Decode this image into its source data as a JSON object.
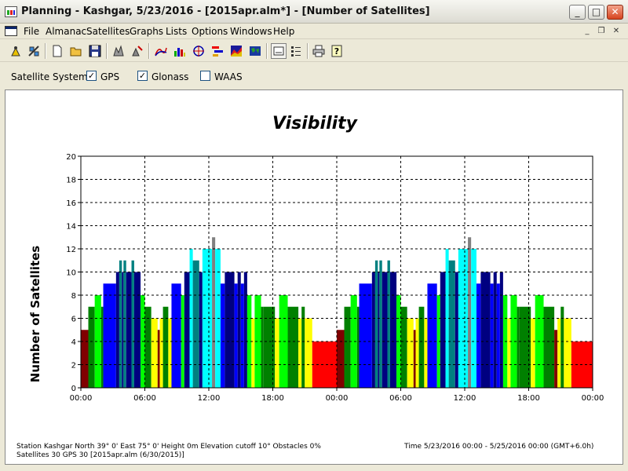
{
  "window": {
    "title": "Planning - Kashgar, 5/23/2016 - [2015apr.alm*] - [Number of Satellites]",
    "buttons": {
      "minimize": "_",
      "maximize": "□",
      "close": "✕"
    }
  },
  "menu": {
    "items": [
      "File",
      "Almanac",
      "Satellites",
      "Graphs",
      "Lists",
      "Options",
      "Windows",
      "Help"
    ],
    "mdi_controls": {
      "minimize": "_",
      "restore": "❐",
      "close": "✕"
    }
  },
  "toolbar": {
    "icons": [
      "station-icon",
      "satellite-icon",
      "new-icon",
      "open-icon",
      "save-icon",
      "obstacle-icon",
      "obstacle-edit-icon",
      "elevation-icon",
      "number-of-satellites-icon",
      "sky-plot-icon",
      "visibility-icon",
      "dop-icon",
      "world-view-icon",
      "view-toggle-icon",
      "legend-icon",
      "print-icon",
      "help-icon"
    ]
  },
  "options": {
    "label": "Satellite Systems:",
    "systems": [
      {
        "name": "GPS",
        "checked": true,
        "mark": "✓"
      },
      {
        "name": "Glonass",
        "checked": true,
        "mark": "✓"
      },
      {
        "name": "WAAS",
        "checked": false,
        "mark": ""
      }
    ]
  },
  "chart_data": {
    "type": "bar",
    "title": "Visibility",
    "ylabel": "Number of Satellites",
    "xlabel": "",
    "ylim": [
      0,
      20
    ],
    "yticks": [
      "0",
      "2",
      "4",
      "6",
      "8",
      "10",
      "12",
      "14",
      "16",
      "18",
      "20"
    ],
    "xticks": [
      "00:00",
      "06:00",
      "12:00",
      "18:00",
      "00:00",
      "06:00",
      "12:00",
      "18:00",
      "00:00"
    ],
    "x_range_hours": [
      0,
      48
    ],
    "grid": true,
    "colors": {
      "4": "#ff0000",
      "5": "#800000",
      "6": "#ffff00",
      "7": "#008000",
      "8": "#00ff00",
      "9": "#0000ff",
      "10": "#000080",
      "11": "#008080",
      "12": "#00ffff",
      "13": "#808080"
    },
    "segments": [
      {
        "start": 0.0,
        "end": 0.7,
        "value": 5
      },
      {
        "start": 0.7,
        "end": 1.3,
        "value": 7
      },
      {
        "start": 1.3,
        "end": 1.9,
        "value": 8
      },
      {
        "start": 1.9,
        "end": 2.1,
        "value": 7
      },
      {
        "start": 2.1,
        "end": 3.3,
        "value": 9
      },
      {
        "start": 3.3,
        "end": 3.6,
        "value": 10
      },
      {
        "start": 3.6,
        "end": 3.85,
        "value": 11
      },
      {
        "start": 3.85,
        "end": 4.0,
        "value": 10
      },
      {
        "start": 4.0,
        "end": 4.25,
        "value": 11
      },
      {
        "start": 4.25,
        "end": 4.75,
        "value": 10
      },
      {
        "start": 4.75,
        "end": 5.0,
        "value": 11
      },
      {
        "start": 5.0,
        "end": 5.6,
        "value": 10
      },
      {
        "start": 5.6,
        "end": 6.0,
        "value": 8
      },
      {
        "start": 6.0,
        "end": 6.6,
        "value": 7
      },
      {
        "start": 6.6,
        "end": 7.2,
        "value": 6
      },
      {
        "start": 7.2,
        "end": 7.4,
        "value": 5
      },
      {
        "start": 7.4,
        "end": 7.7,
        "value": 6
      },
      {
        "start": 7.7,
        "end": 8.2,
        "value": 7
      },
      {
        "start": 8.2,
        "end": 8.5,
        "value": 6
      },
      {
        "start": 8.5,
        "end": 9.4,
        "value": 9
      },
      {
        "start": 9.4,
        "end": 9.7,
        "value": 8
      },
      {
        "start": 9.7,
        "end": 10.2,
        "value": 10
      },
      {
        "start": 10.2,
        "end": 10.5,
        "value": 12
      },
      {
        "start": 10.5,
        "end": 11.1,
        "value": 11
      },
      {
        "start": 11.1,
        "end": 11.4,
        "value": 10
      },
      {
        "start": 11.4,
        "end": 12.3,
        "value": 12
      },
      {
        "start": 12.3,
        "end": 12.6,
        "value": 13
      },
      {
        "start": 12.6,
        "end": 13.1,
        "value": 12
      },
      {
        "start": 13.1,
        "end": 13.5,
        "value": 9
      },
      {
        "start": 13.5,
        "end": 14.4,
        "value": 10
      },
      {
        "start": 14.4,
        "end": 14.7,
        "value": 9
      },
      {
        "start": 14.7,
        "end": 15.0,
        "value": 10
      },
      {
        "start": 15.0,
        "end": 15.3,
        "value": 9
      },
      {
        "start": 15.3,
        "end": 15.6,
        "value": 10
      },
      {
        "start": 15.6,
        "end": 16.0,
        "value": 8
      },
      {
        "start": 16.0,
        "end": 16.3,
        "value": 6
      },
      {
        "start": 16.3,
        "end": 16.9,
        "value": 8
      },
      {
        "start": 16.9,
        "end": 17.1,
        "value": 7
      },
      {
        "start": 17.1,
        "end": 18.2,
        "value": 7
      },
      {
        "start": 18.2,
        "end": 18.6,
        "value": 6
      },
      {
        "start": 18.6,
        "end": 19.4,
        "value": 8
      },
      {
        "start": 19.4,
        "end": 20.4,
        "value": 7
      },
      {
        "start": 20.4,
        "end": 20.7,
        "value": 6
      },
      {
        "start": 20.7,
        "end": 21.0,
        "value": 7
      },
      {
        "start": 21.0,
        "end": 21.7,
        "value": 6
      },
      {
        "start": 21.7,
        "end": 24.0,
        "value": 4
      },
      {
        "start": 24.0,
        "end": 24.7,
        "value": 5
      },
      {
        "start": 24.7,
        "end": 25.3,
        "value": 7
      },
      {
        "start": 25.3,
        "end": 25.9,
        "value": 8
      },
      {
        "start": 25.9,
        "end": 26.1,
        "value": 7
      },
      {
        "start": 26.1,
        "end": 27.3,
        "value": 9
      },
      {
        "start": 27.3,
        "end": 27.6,
        "value": 10
      },
      {
        "start": 27.6,
        "end": 27.85,
        "value": 11
      },
      {
        "start": 27.85,
        "end": 28.0,
        "value": 10
      },
      {
        "start": 28.0,
        "end": 28.25,
        "value": 11
      },
      {
        "start": 28.25,
        "end": 28.75,
        "value": 10
      },
      {
        "start": 28.75,
        "end": 29.0,
        "value": 11
      },
      {
        "start": 29.0,
        "end": 29.6,
        "value": 10
      },
      {
        "start": 29.6,
        "end": 30.0,
        "value": 8
      },
      {
        "start": 30.0,
        "end": 30.6,
        "value": 7
      },
      {
        "start": 30.6,
        "end": 31.2,
        "value": 6
      },
      {
        "start": 31.2,
        "end": 31.4,
        "value": 5
      },
      {
        "start": 31.4,
        "end": 31.7,
        "value": 6
      },
      {
        "start": 31.7,
        "end": 32.2,
        "value": 7
      },
      {
        "start": 32.2,
        "end": 32.5,
        "value": 6
      },
      {
        "start": 32.5,
        "end": 33.4,
        "value": 9
      },
      {
        "start": 33.4,
        "end": 33.7,
        "value": 8
      },
      {
        "start": 33.7,
        "end": 34.2,
        "value": 10
      },
      {
        "start": 34.2,
        "end": 34.5,
        "value": 12
      },
      {
        "start": 34.5,
        "end": 35.1,
        "value": 11
      },
      {
        "start": 35.1,
        "end": 35.4,
        "value": 10
      },
      {
        "start": 35.4,
        "end": 36.3,
        "value": 12
      },
      {
        "start": 36.3,
        "end": 36.6,
        "value": 13
      },
      {
        "start": 36.6,
        "end": 37.1,
        "value": 12
      },
      {
        "start": 37.1,
        "end": 37.5,
        "value": 9
      },
      {
        "start": 37.5,
        "end": 38.4,
        "value": 10
      },
      {
        "start": 38.4,
        "end": 38.7,
        "value": 9
      },
      {
        "start": 38.7,
        "end": 39.0,
        "value": 10
      },
      {
        "start": 39.0,
        "end": 39.3,
        "value": 9
      },
      {
        "start": 39.3,
        "end": 39.6,
        "value": 10
      },
      {
        "start": 39.6,
        "end": 40.0,
        "value": 8
      },
      {
        "start": 40.0,
        "end": 40.3,
        "value": 6
      },
      {
        "start": 40.3,
        "end": 40.9,
        "value": 8
      },
      {
        "start": 40.9,
        "end": 41.1,
        "value": 7
      },
      {
        "start": 41.1,
        "end": 42.2,
        "value": 7
      },
      {
        "start": 42.2,
        "end": 42.6,
        "value": 6
      },
      {
        "start": 42.6,
        "end": 43.4,
        "value": 8
      },
      {
        "start": 43.4,
        "end": 44.4,
        "value": 7
      },
      {
        "start": 44.4,
        "end": 44.7,
        "value": 5
      },
      {
        "start": 44.7,
        "end": 45.0,
        "value": 6
      },
      {
        "start": 45.0,
        "end": 45.3,
        "value": 7
      },
      {
        "start": 45.3,
        "end": 46.0,
        "value": 6
      },
      {
        "start": 46.0,
        "end": 48.0,
        "value": 4
      }
    ]
  },
  "status": {
    "station": "Station Kashgar   North 39° 0'    East 75° 0'    Height 0m        Elevation cutoff 10°  Obstacles 0%",
    "time": "Time 5/23/2016 00:00 -   5/25/2016 00:00  (GMT+6.0h)",
    "satellites": "Satellites 30   GPS 30   [2015apr.alm (6/30/2015)]"
  }
}
